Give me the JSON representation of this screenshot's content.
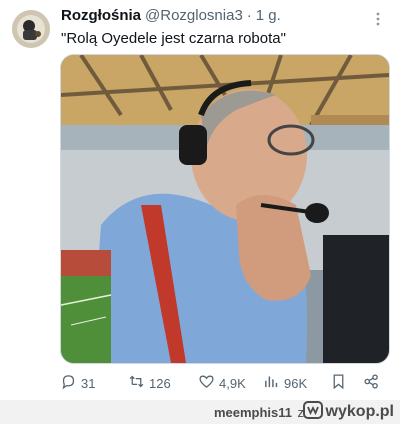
{
  "tweet": {
    "author_name": "Rozgłośnia",
    "handle": "@Rozglosnia3",
    "separator": "·",
    "time": "1 g.",
    "text": "\"Rolą Oyedele jest czarna robota\""
  },
  "actions": {
    "replies": "31",
    "retweets": "126",
    "likes": "4,9K",
    "views": "96K"
  },
  "icons": [
    "more-icon",
    "reply-icon",
    "retweet-icon",
    "like-icon",
    "views-icon",
    "bookmark-icon",
    "share-icon",
    "wykop-logo-icon"
  ],
  "watermark": {
    "user": "meemphis11",
    "connector": "z",
    "site": "wykop.pl"
  },
  "colors": {
    "secondary_text": "#536471",
    "primary_text": "#0f1419",
    "footer_bg": "#f2f2f2"
  }
}
